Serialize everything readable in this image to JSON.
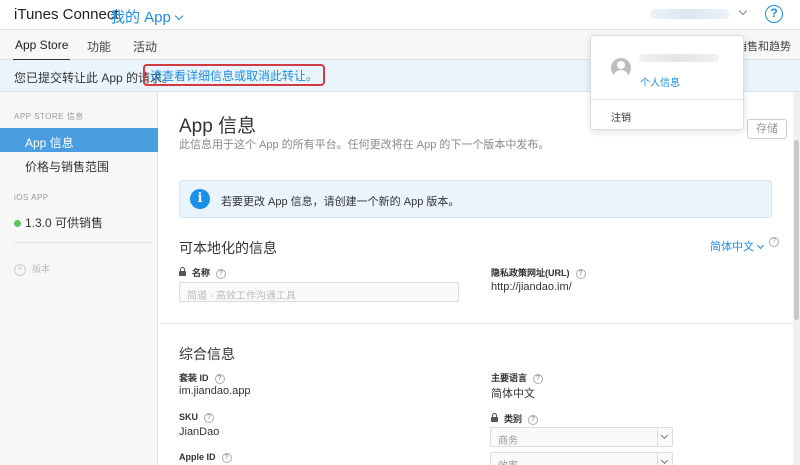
{
  "header": {
    "brand": "iTunes Connect",
    "app_menu": "我的 App",
    "help": "?"
  },
  "tabs": [
    {
      "label": "App Store"
    },
    {
      "label": "功能"
    },
    {
      "label": "活动"
    }
  ],
  "tabs_right_label": "销售和趋势",
  "notice": {
    "text": "您已提交转让此 App 的请求。",
    "link": "请查看详细信息或取消此转让。"
  },
  "sidebar": {
    "section_app_store": "APP STORE 信息",
    "items": [
      {
        "label": "App 信息"
      },
      {
        "label": "价格与销售范围"
      }
    ],
    "section_ios": "iOS APP",
    "version": "1.3.0 可供销售",
    "add_version": "版本"
  },
  "main": {
    "title": "App 信息",
    "subtitle": "此信息用于这个 App 的所有平台。任何更改将在 App 的下一个版本中发布。",
    "save_label": "存储",
    "info_icon": "i",
    "info_text": "若要更改 App 信息，请创建一个新的 App 版本。",
    "localizable_title": "可本地化的信息",
    "language": "简体中文",
    "name_label": "名称",
    "name_placeholder": "简道 - 高效工作沟通工具",
    "privacy_label": "隐私政策网址(URL)",
    "privacy_value": "http://jiandao.im/",
    "general_title": "综合信息",
    "bundle_label": "套装 ID",
    "bundle_value": "im.jiandao.app",
    "primary_lang_label": "主要语言",
    "primary_lang_value": "简体中文",
    "sku_label": "SKU",
    "sku_value": "JianDao",
    "category_label": "类别",
    "category_primary": "商务",
    "category_secondary": "效率",
    "apple_id_label": "Apple ID",
    "q": "?"
  },
  "dropdown": {
    "profile": "个人信息",
    "signout": "注销"
  },
  "colors": {
    "accent": "#1c8fe8",
    "sidebar_active": "#4a9ee0",
    "notice_bg": "#eaf4fc",
    "highlight_border": "#d23a44",
    "status_green": "#5cc45c"
  }
}
